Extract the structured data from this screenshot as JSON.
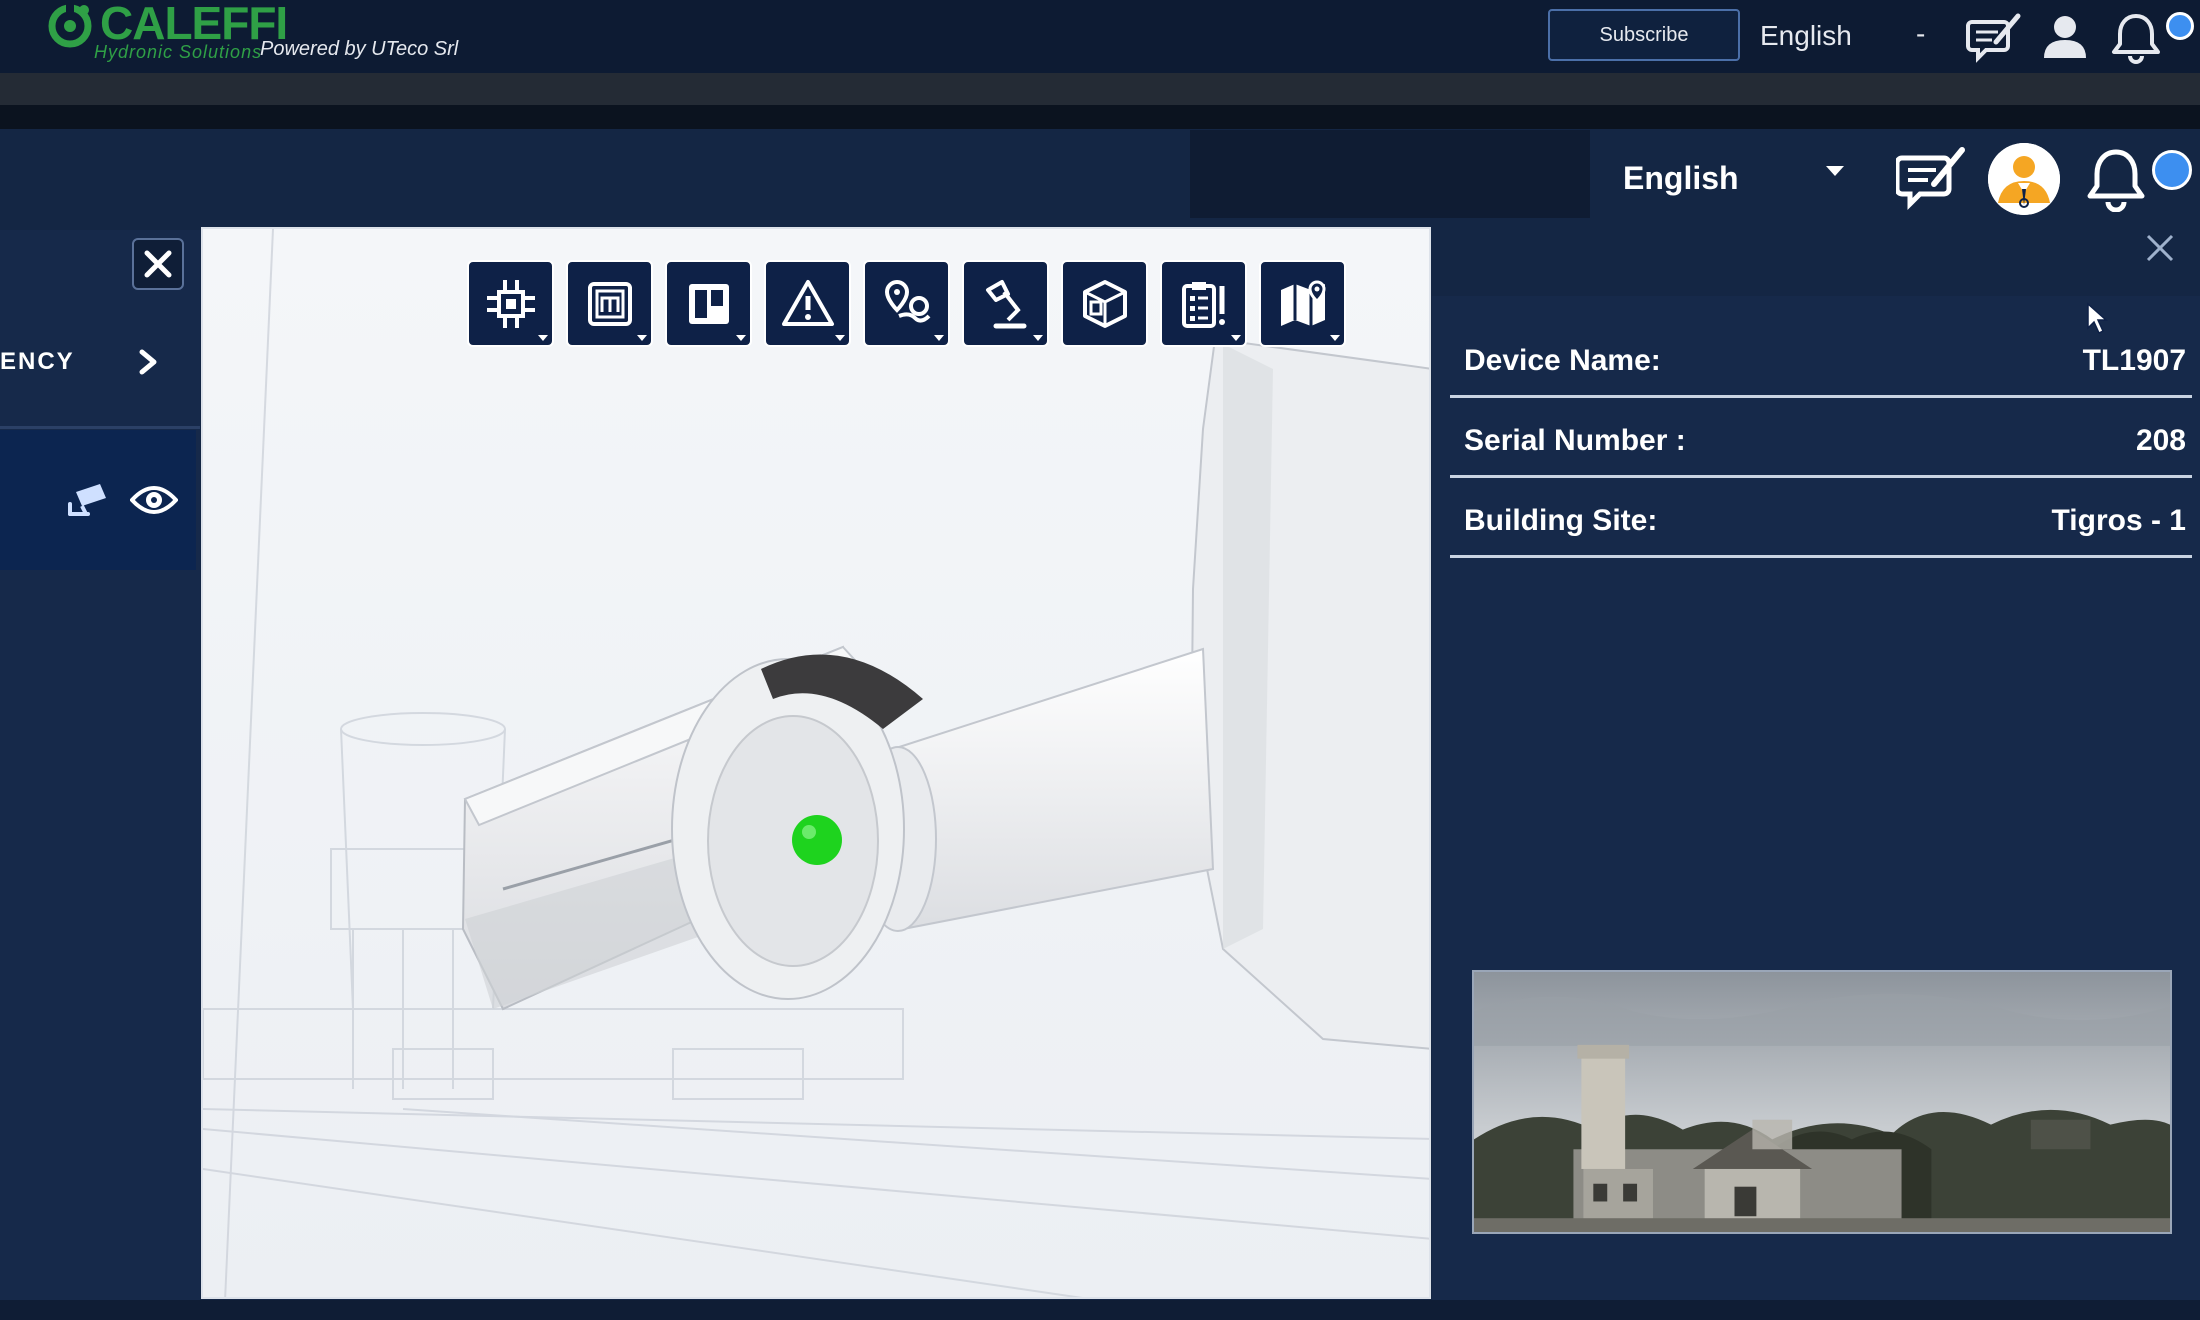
{
  "topbar": {
    "logo_text": "CALEFFI",
    "logo_tagline": "Hydronic Solutions",
    "powered_by": "Powered by UTeco Srl",
    "subscribe_label": "Subscribe",
    "language": "English",
    "language_dropdown": "-"
  },
  "header": {
    "language": "English"
  },
  "left_panel": {
    "category_label": "ENCY"
  },
  "viewer": {
    "toolbar": [
      {
        "name": "components-tool",
        "icon": "circuit-chip-icon"
      },
      {
        "name": "meter-tool",
        "icon": "meter-m-icon"
      },
      {
        "name": "board-tool",
        "icon": "kanban-board-icon"
      },
      {
        "name": "alerts-tool",
        "icon": "warning-triangle-icon"
      },
      {
        "name": "location-tool",
        "icon": "map-pin-route-icon"
      },
      {
        "name": "lighting-tool",
        "icon": "desk-lamp-icon"
      },
      {
        "name": "model-tool",
        "icon": "3d-cube-icon"
      },
      {
        "name": "checklist-tool",
        "icon": "clipboard-checklist-icon"
      },
      {
        "name": "map-tool",
        "icon": "folded-map-icon"
      }
    ],
    "status_color": "#1ed31e"
  },
  "device_info": {
    "rows": [
      {
        "label": "Device Name:",
        "value": "TL1907"
      },
      {
        "label": "Serial Number :",
        "value": "208"
      },
      {
        "label": "Building Site:",
        "value": "Tigros - 1"
      }
    ]
  },
  "colors": {
    "background": "#142644",
    "topbar": "#0d1b33",
    "accent_blue": "#3d8ff0",
    "brand_green": "#2fa046",
    "avatar_orange": "#f5a623"
  }
}
